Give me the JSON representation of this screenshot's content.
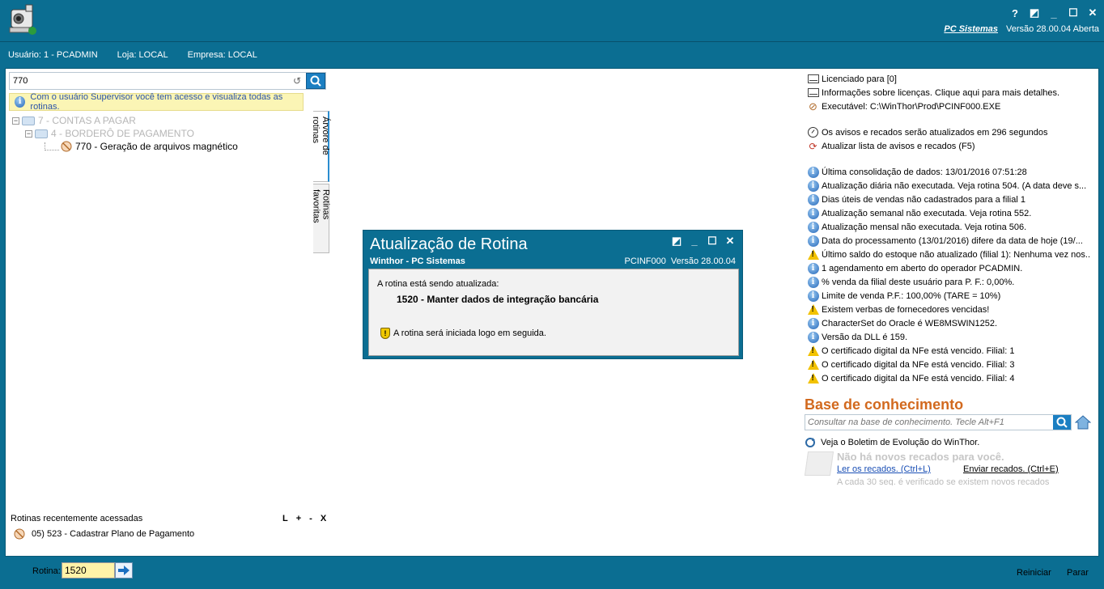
{
  "titlebar": {
    "controls": [
      "?",
      "◩",
      "_",
      "☐",
      "✕"
    ],
    "brand_link": "PC Sistemas",
    "version": "Versão 28.00.04 Aberta"
  },
  "userbar": {
    "usuario": "Usuário: 1 - PCADMIN",
    "loja": "Loja: LOCAL",
    "empresa": "Empresa: LOCAL"
  },
  "search": {
    "value": "770"
  },
  "info_bar": "Com o usuário Supervisor você tem acesso e visualiza todas as rotinas.",
  "tree": {
    "level1": "7 - CONTAS A PAGAR",
    "level2": "4 - BORDERÔ DE PAGAMENTO",
    "level3": "770 - Geração de arquivos magnético"
  },
  "tabs": {
    "tree": "Árvore de rotinas",
    "favorites": "Rotinas favoritas"
  },
  "recent": {
    "title": "Rotinas recentemente acessadas",
    "controls": [
      "L",
      "+",
      "-",
      "X"
    ],
    "item": "05)  523 - Cadastrar Plano de Pagamento"
  },
  "notices": [
    {
      "icon": "mail",
      "text": "Licenciado para [0]"
    },
    {
      "icon": "mail",
      "text": "Informações sobre licenças. Clique aqui para mais detalhes."
    },
    {
      "icon": "executable",
      "text": "Executável: C:\\WinThor\\Prod\\PCINF000.EXE"
    },
    {
      "icon": "gap",
      "text": ""
    },
    {
      "icon": "clock",
      "text": "Os avisos e recados serão atualizados em 296 segundos"
    },
    {
      "icon": "refresh",
      "text": "Atualizar lista de avisos e recados (F5)"
    },
    {
      "icon": "gap",
      "text": ""
    },
    {
      "icon": "info",
      "text": "Última consolidação de dados: 13/01/2016 07:51:28"
    },
    {
      "icon": "info",
      "text": "Atualização diária não executada. Veja rotina 504. (A data deve s..."
    },
    {
      "icon": "info",
      "text": "Dias úteis de vendas não cadastrados para a filial 1"
    },
    {
      "icon": "info",
      "text": "Atualização semanal não executada. Veja rotina 552."
    },
    {
      "icon": "info",
      "text": "Atualização mensal não executada. Veja rotina 506."
    },
    {
      "icon": "info",
      "text": "Data do processamento (13/01/2016) difere da data de hoje (19/..."
    },
    {
      "icon": "warning",
      "text": "Último saldo do estoque não atualizado (filial 1): Nenhuma vez nos..."
    },
    {
      "icon": "info",
      "text": "1 agendamento em aberto do operador PCADMIN."
    },
    {
      "icon": "info",
      "text": "% venda da filial deste usuário para P. F.: 0,00%."
    },
    {
      "icon": "info",
      "text": "Limite de venda P.F.: 100,00% (TARE = 10%)"
    },
    {
      "icon": "warning",
      "text": "Existem verbas de fornecedores vencidas!"
    },
    {
      "icon": "info",
      "text": "CharacterSet do Oracle é WE8MSWIN1252."
    },
    {
      "icon": "info",
      "text": "Versão da DLL é 159."
    },
    {
      "icon": "warning",
      "text": "O certificado digital da NFe está vencido. Filial: 1"
    },
    {
      "icon": "warning",
      "text": "O certificado digital da NFe está vencido. Filial: 3"
    },
    {
      "icon": "warning",
      "text": "O certificado digital da NFe está vencido. Filial: 4"
    }
  ],
  "knowledge": {
    "title": "Base de conhecimento",
    "placeholder": "Consultar na base de conhecimento. Tecle Alt+F1",
    "bulletin": "Veja o Boletim de Evolução do WinThor.",
    "no_messages": "Não há novos recados para você.",
    "read_link": "Ler os recados. (Ctrl+L)",
    "send_link": "Enviar recados. (Ctrl+E)",
    "every30": "A cada 30 seg. é verificado se existem novos recados"
  },
  "dialog": {
    "title": "Atualização de Rotina",
    "subtitle": "Winthor - PC Sistemas",
    "code": "PCINF000",
    "version": "Versão 28.00.04",
    "line1": "A rotina está sendo atualizada:",
    "line2": "1520 - Manter dados de integração bancária",
    "line3": "A rotina será iniciada logo em seguida.",
    "controls": [
      "◩",
      "_",
      "☐",
      "✕"
    ]
  },
  "bottom": {
    "rotina_label": "Rotina:",
    "rotina_value": "1520",
    "reiniciar": "Reiniciar",
    "parar": "Parar"
  }
}
